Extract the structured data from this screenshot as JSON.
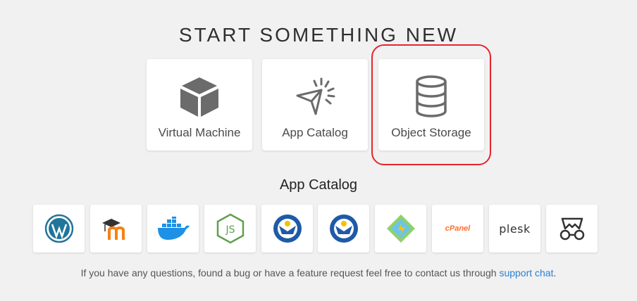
{
  "header": {
    "title": "START SOMETHING NEW"
  },
  "cards": [
    {
      "label": "Virtual Machine",
      "icon": "cube-icon"
    },
    {
      "label": "App Catalog",
      "icon": "cursor-click-icon"
    },
    {
      "label": "Object Storage",
      "icon": "database-icon"
    }
  ],
  "app_catalog": {
    "title": "App Catalog",
    "apps": [
      {
        "icon": "wordpress-icon"
      },
      {
        "icon": "moodle-icon"
      },
      {
        "icon": "docker-icon"
      },
      {
        "icon": "nodejs-icon"
      },
      {
        "icon": "tut-wuri-handayani-icon"
      },
      {
        "icon": "tut-wuri-handayani-icon"
      },
      {
        "icon": "app-diamond-icon"
      },
      {
        "icon": "cpanel-icon",
        "text": "cPanel"
      },
      {
        "icon": "plesk-icon",
        "text": "plesk"
      },
      {
        "icon": "app-glasses-icon"
      }
    ]
  },
  "footer": {
    "text": "If you have any questions, found a bug or have a feature request feel free to contact us through",
    "link": "support chat",
    "end": "."
  },
  "colors": {
    "background": "#f1f1f1",
    "highlight": "#e8242b",
    "link": "#2a7fd4",
    "icon_gray": "#6b6b6b"
  }
}
